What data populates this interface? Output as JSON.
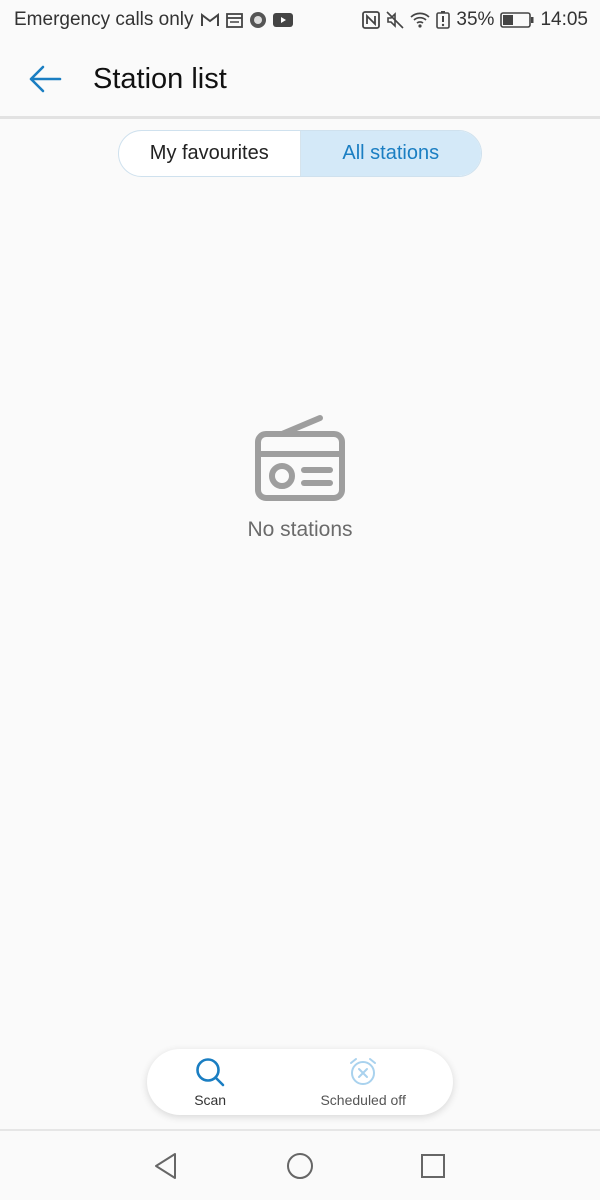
{
  "status_bar": {
    "carrier_text": "Emergency calls only",
    "battery_percent": "35%",
    "time": "14:05",
    "left_icons": [
      "gmail-icon",
      "calendar-icon",
      "circle-app-icon",
      "youtube-icon"
    ],
    "right_icons": [
      "nfc-icon",
      "mute-icon",
      "wifi-icon",
      "battery-alert-icon",
      "battery-icon"
    ]
  },
  "header": {
    "title": "Station list",
    "back_icon": "arrow-left-icon"
  },
  "tabs": [
    {
      "label": "My favourites",
      "selected": false
    },
    {
      "label": "All stations",
      "selected": true
    }
  ],
  "empty_state": {
    "icon": "radio-icon",
    "text": "No stations"
  },
  "actions": {
    "scan": {
      "label": "Scan",
      "icon": "search-icon"
    },
    "scheduled": {
      "label": "Scheduled off",
      "icon": "alarm-off-icon"
    }
  },
  "navigation": [
    "back-triangle-icon",
    "home-circle-icon",
    "recents-square-icon"
  ],
  "colors": {
    "accent": "#1a7ec2",
    "tab_selected_bg": "#d4e9f8",
    "background": "#fafafa",
    "empty_icon": "#9e9e9e"
  }
}
